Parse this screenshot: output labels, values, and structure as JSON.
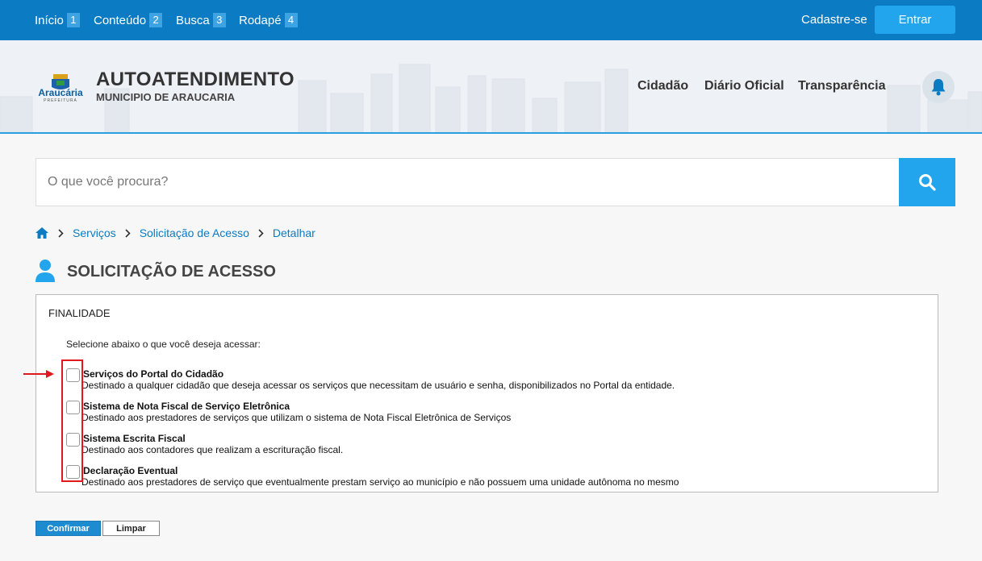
{
  "topbar": {
    "skip_links": [
      {
        "label": "Início",
        "key": "1"
      },
      {
        "label": "Conteúdo",
        "key": "2"
      },
      {
        "label": "Busca",
        "key": "3"
      },
      {
        "label": "Rodapé",
        "key": "4"
      }
    ],
    "register_label": "Cadastre-se",
    "login_label": "Entrar"
  },
  "header": {
    "logo_text": "Araucária",
    "logo_sub": "PREFEITURA",
    "title": "AUTOATENDIMENTO",
    "subtitle": "MUNICIPIO DE ARAUCARIA",
    "nav": [
      "Cidadão",
      "Diário Oficial",
      "Transparência"
    ],
    "bell_icon": "bell-icon"
  },
  "search": {
    "placeholder": "O que você procura?",
    "icon": "search-icon"
  },
  "breadcrumb": {
    "home_icon": "home-icon",
    "items": [
      "Serviços",
      "Solicitação de Acesso",
      "Detalhar"
    ]
  },
  "page": {
    "title": "SOLICITAÇÃO DE ACESSO",
    "icon": "user-icon"
  },
  "form": {
    "legend": "FINALIDADE",
    "instruction": "Selecione abaixo o que você deseja acessar:",
    "options": [
      {
        "title": "Serviços do Portal do Cidadão",
        "description": "Destinado a qualquer cidadão que deseja acessar os serviços que necessitam de usuário e senha, disponibilizados no Portal da entidade.",
        "checked": false
      },
      {
        "title": "Sistema de Nota Fiscal de Serviço Eletrônica",
        "description": "Destinado aos prestadores de serviços que utilizam o sistema de Nota Fiscal Eletrônica de Serviços",
        "checked": false
      },
      {
        "title": "Sistema Escrita Fiscal",
        "description": "Destinado aos contadores que realizam a escrituração fiscal.",
        "checked": false
      },
      {
        "title": "Declaração Eventual",
        "description": "Destinado aos prestadores de serviço que eventualmente prestam serviço ao município e não possuem uma unidade autônoma no mesmo",
        "checked": false
      }
    ],
    "confirm_label": "Confirmar",
    "clear_label": "Limpar"
  },
  "colors": {
    "primary": "#0b7cc3",
    "accent": "#22a5ec",
    "highlight": "#e0191f"
  }
}
